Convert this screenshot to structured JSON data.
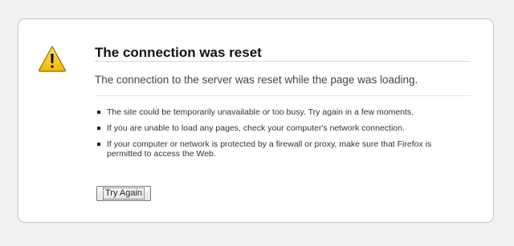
{
  "error": {
    "icon": "warning-icon",
    "title": "The connection was reset",
    "short_desc": "The connection to the server was reset while the page was loading.",
    "details": [
      "The site could be temporarily unavailable or too busy. Try again in a few moments.",
      "If you are unable to load any pages, check your computer's network connection.",
      "If your computer or network is protected by a firewall or proxy, make sure that Firefox is permitted to access the Web."
    ],
    "button_label": "Try Again"
  },
  "colors": {
    "page_background": "#f1f1f1",
    "box_background": "#ffffff",
    "warning_yellow": "#f5c400"
  }
}
